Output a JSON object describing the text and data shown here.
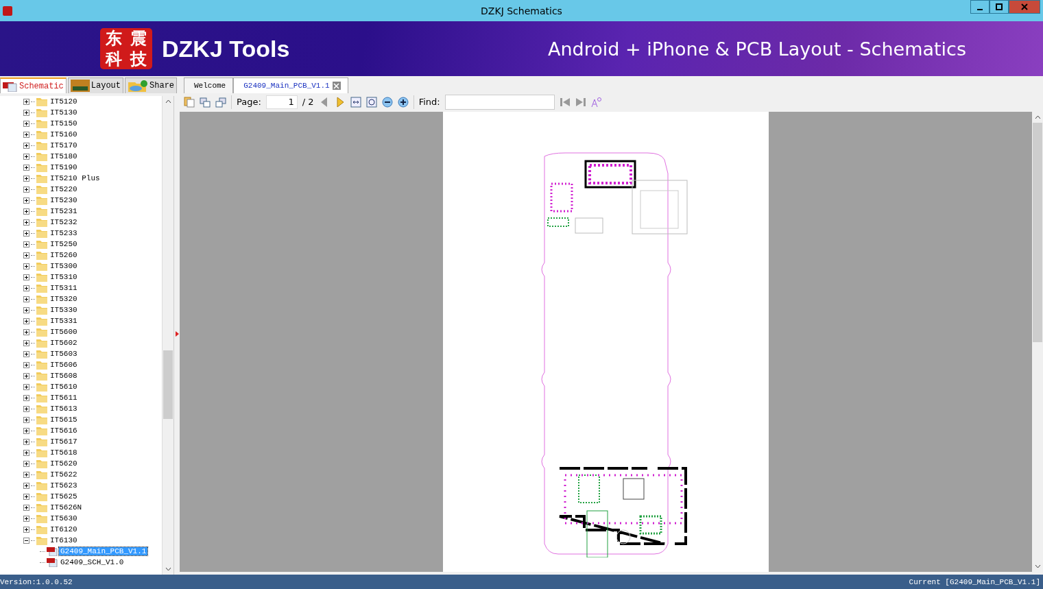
{
  "window": {
    "title": "DZKJ Schematics"
  },
  "banner": {
    "logo_chars": [
      "东",
      "震",
      "科",
      "技"
    ],
    "brand": "DZKJ Tools",
    "tagline": "Android + iPhone & PCB Layout - Schematics"
  },
  "side_tabs": [
    {
      "label": "Schematic",
      "kind": "pdf",
      "selected": true
    },
    {
      "label": "Layout",
      "kind": "pads",
      "selected": false
    },
    {
      "label": "Share",
      "kind": "share",
      "selected": false
    }
  ],
  "doc_tabs": [
    {
      "label": "Welcome",
      "selected": false,
      "closable": false
    },
    {
      "label": "G2409_Main_PCB_V1.1",
      "selected": true,
      "closable": true
    }
  ],
  "tree": {
    "items": [
      {
        "label": "IT5120",
        "expanded": false
      },
      {
        "label": "IT5130",
        "expanded": false
      },
      {
        "label": "IT5150",
        "expanded": false
      },
      {
        "label": "IT5160",
        "expanded": false
      },
      {
        "label": "IT5170",
        "expanded": false
      },
      {
        "label": "IT5180",
        "expanded": false
      },
      {
        "label": "IT5190",
        "expanded": false
      },
      {
        "label": "IT5210 Plus",
        "expanded": false
      },
      {
        "label": "IT5220",
        "expanded": false
      },
      {
        "label": "IT5230",
        "expanded": false
      },
      {
        "label": "IT5231",
        "expanded": false
      },
      {
        "label": "IT5232",
        "expanded": false
      },
      {
        "label": "IT5233",
        "expanded": false
      },
      {
        "label": "IT5250",
        "expanded": false
      },
      {
        "label": "IT5260",
        "expanded": false
      },
      {
        "label": "IT5300",
        "expanded": false
      },
      {
        "label": "IT5310",
        "expanded": false
      },
      {
        "label": "IT5311",
        "expanded": false
      },
      {
        "label": "IT5320",
        "expanded": false
      },
      {
        "label": "IT5330",
        "expanded": false
      },
      {
        "label": "IT5331",
        "expanded": false
      },
      {
        "label": "IT5600",
        "expanded": false
      },
      {
        "label": "IT5602",
        "expanded": false
      },
      {
        "label": "IT5603",
        "expanded": false
      },
      {
        "label": "IT5606",
        "expanded": false
      },
      {
        "label": "IT5608",
        "expanded": false
      },
      {
        "label": "IT5610",
        "expanded": false
      },
      {
        "label": "IT5611",
        "expanded": false
      },
      {
        "label": "IT5613",
        "expanded": false
      },
      {
        "label": "IT5615",
        "expanded": false
      },
      {
        "label": "IT5616",
        "expanded": false
      },
      {
        "label": "IT5617",
        "expanded": false
      },
      {
        "label": "IT5618",
        "expanded": false
      },
      {
        "label": "IT5620",
        "expanded": false
      },
      {
        "label": "IT5622",
        "expanded": false
      },
      {
        "label": "IT5623",
        "expanded": false
      },
      {
        "label": "IT5625",
        "expanded": false
      },
      {
        "label": "IT5626N",
        "expanded": false
      },
      {
        "label": "IT5630",
        "expanded": false
      },
      {
        "label": "IT6120",
        "expanded": false
      },
      {
        "label": "IT6130",
        "expanded": true,
        "children": [
          {
            "label": "G2409_Main_PCB_V1.1",
            "selected": true
          },
          {
            "label": "G2409_SCH_V1.0",
            "selected": false
          }
        ]
      }
    ]
  },
  "toolbar": {
    "page_label": "Page:",
    "page_value": "1",
    "page_total": "/ 2",
    "find_label": "Find:"
  },
  "status_bar": {
    "version": "Version:1.0.0.52",
    "current": "Current [G2409_Main_PCB_V1.1]"
  }
}
